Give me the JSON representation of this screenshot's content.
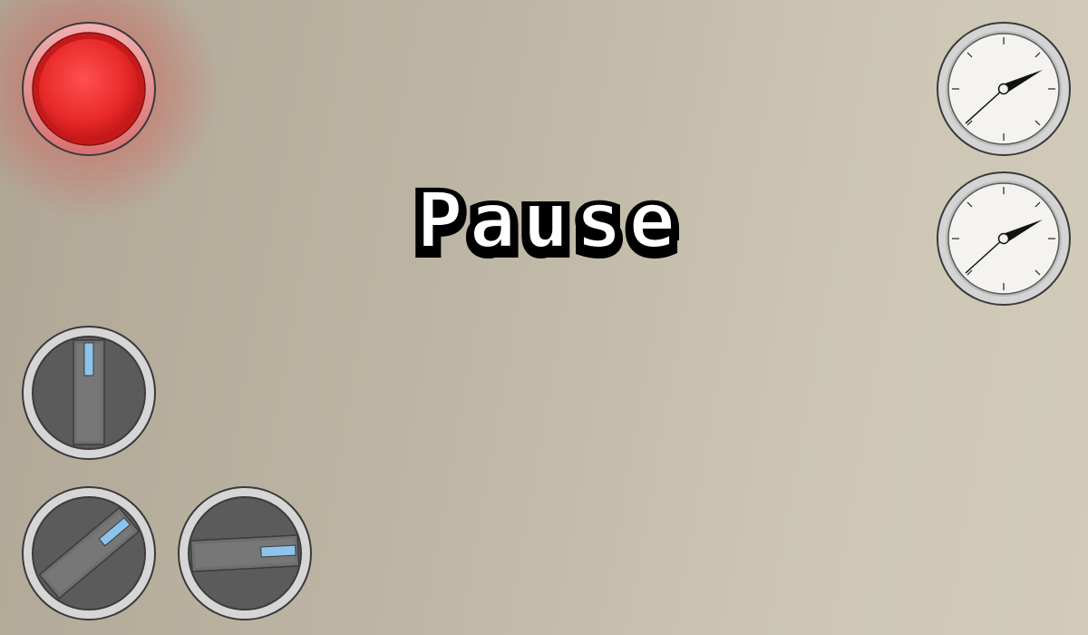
{
  "hud": {
    "pause_label": "Pause",
    "alarm_button": {
      "icon": "red-alarm-button",
      "color": "#e52b2b",
      "glow": true
    },
    "gauges": [
      {
        "name": "pressure-gauge-top",
        "icon": "dial-gauge-icon"
      },
      {
        "name": "pressure-gauge-bottom",
        "icon": "dial-gauge-icon"
      }
    ],
    "knobs": [
      {
        "name": "knob-vertical",
        "icon": "rotary-knob-icon"
      },
      {
        "name": "knob-diagonal",
        "icon": "rotary-knob-icon"
      },
      {
        "name": "knob-horizontal",
        "icon": "rotary-knob-icon"
      }
    ],
    "colors": {
      "knob_indicator": "#8cc4ee",
      "knob_body": "#5b5b5b",
      "bezel": "#cfcfcf",
      "gauge_face": "#f4f3ef"
    }
  }
}
